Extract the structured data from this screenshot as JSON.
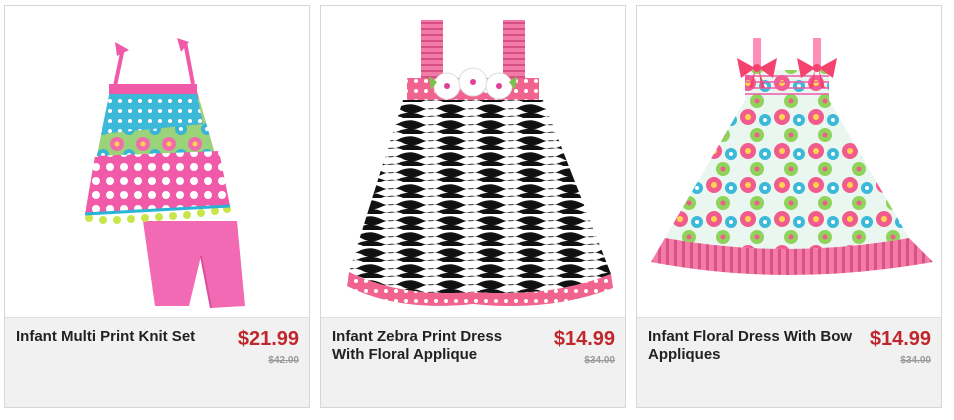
{
  "products": [
    {
      "name": "Infant Multi Print Knit Set",
      "price": "$21.99",
      "original_price": "$42.00",
      "image_icon": "multi-print-knit-set-image"
    },
    {
      "name": "Infant Zebra Print Dress With Floral Applique",
      "price": "$14.99",
      "original_price": "$34.00",
      "image_icon": "zebra-print-dress-image"
    },
    {
      "name": "Infant Floral Dress With Bow Appliques",
      "price": "$14.99",
      "original_price": "$34.00",
      "image_icon": "floral-dress-image"
    }
  ],
  "colors": {
    "price": "#c0272d",
    "info_bg": "#f1f1f1",
    "border": "#d6d6d6"
  }
}
